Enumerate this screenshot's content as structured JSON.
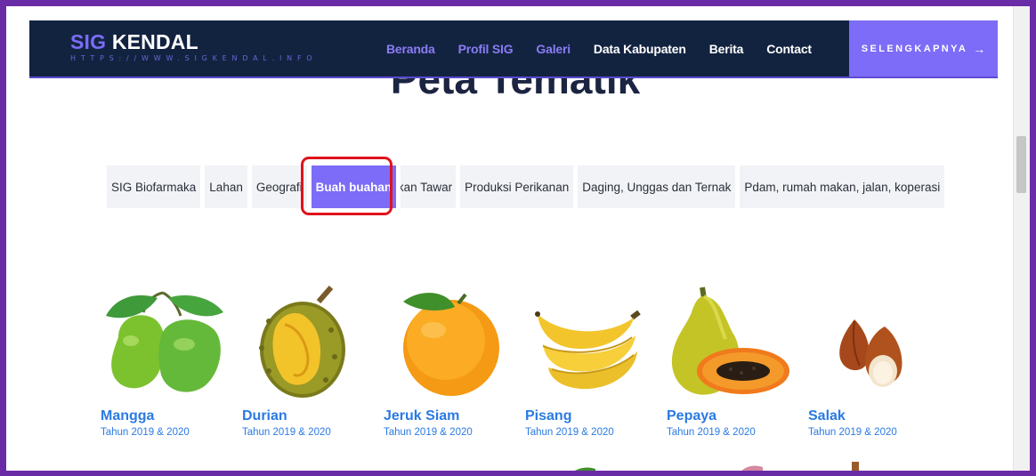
{
  "brand": {
    "title_accent": "SIG",
    "title_rest": " KENDAL",
    "subtitle": "HTTPS://WWW.SIGKENDAL.INFO"
  },
  "nav": {
    "items": [
      {
        "label": "Beranda",
        "style": "muted"
      },
      {
        "label": "Profil SIG",
        "style": "muted"
      },
      {
        "label": "Galeri",
        "style": "muted"
      },
      {
        "label": "Data Kabupaten",
        "style": "normal"
      },
      {
        "label": "Berita",
        "style": "normal"
      },
      {
        "label": "Contact",
        "style": "normal"
      }
    ],
    "cta_label": "SELENGKAPNYA",
    "cta_icon": "arrow-right-icon"
  },
  "page": {
    "heading": "Peta Tematik"
  },
  "tabs": [
    {
      "label": "SIG Biofarmaka",
      "active": false
    },
    {
      "label": "Lahan",
      "active": false
    },
    {
      "label": "Geografi",
      "active": false
    },
    {
      "label": "Buah buahan",
      "active": true
    },
    {
      "label": "Ikan Tawar",
      "active": false
    },
    {
      "label": "Produksi Perikanan",
      "active": false
    },
    {
      "label": "Daging, Unggas dan Ternak",
      "active": false
    },
    {
      "label": "Pdam, rumah makan, jalan, koperasi",
      "active": false
    }
  ],
  "fruits": [
    {
      "name": "Mangga",
      "subtitle": "Tahun 2019 & 2020",
      "icon": "mango-image"
    },
    {
      "name": "Durian",
      "subtitle": "Tahun 2019 & 2020",
      "icon": "durian-image"
    },
    {
      "name": "Jeruk Siam",
      "subtitle": "Tahun 2019 & 2020",
      "icon": "orange-image"
    },
    {
      "name": "Pisang",
      "subtitle": "Tahun 2019 & 2020",
      "icon": "banana-image"
    },
    {
      "name": "Pepaya",
      "subtitle": "Tahun 2019 & 2020",
      "icon": "papaya-image"
    },
    {
      "name": "Salak",
      "subtitle": "Tahun 2019 & 2020",
      "icon": "salak-image"
    }
  ],
  "colors": {
    "frame": "#6a2ba6",
    "navbar": "#122340",
    "accent": "#7d6cf7",
    "link": "#2a7ae2",
    "highlight": "#e0121b"
  }
}
